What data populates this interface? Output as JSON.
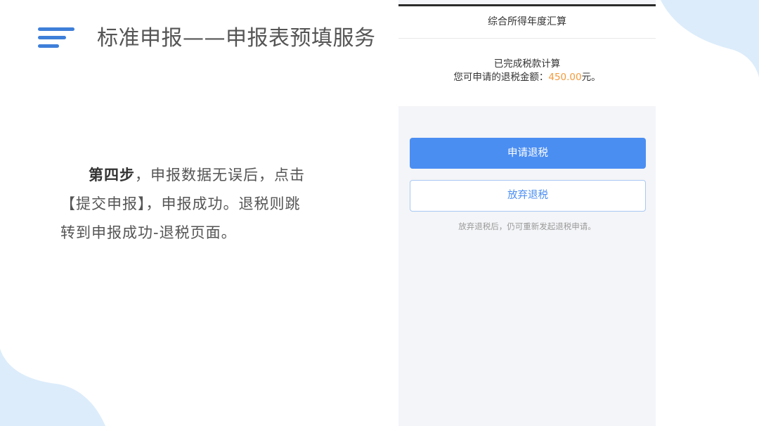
{
  "slide": {
    "title": "标准申报——申报表预填服务",
    "step": {
      "bold": "第四步",
      "rest": "，申报数据无误后，点击【提交申报】，申报成功。退税则跳转到申报成功-退税页面。"
    }
  },
  "phone": {
    "nav_title": "综合所得年度汇算",
    "status_line": "已完成税款计算",
    "refund_prefix": "您可申请的退税金额：",
    "refund_amount": "450.00",
    "refund_suffix": "元。",
    "apply_button": "申请退税",
    "abandon_button": "放弃退税",
    "hint": "放弃退税后，仍可重新发起退税申请。"
  },
  "colors": {
    "accent": "#4b8ef2",
    "amount": "#f39a3c",
    "menu_icon": "#3e7fd9",
    "blob": "#dcecfb"
  },
  "icons": [
    "menu-icon"
  ]
}
